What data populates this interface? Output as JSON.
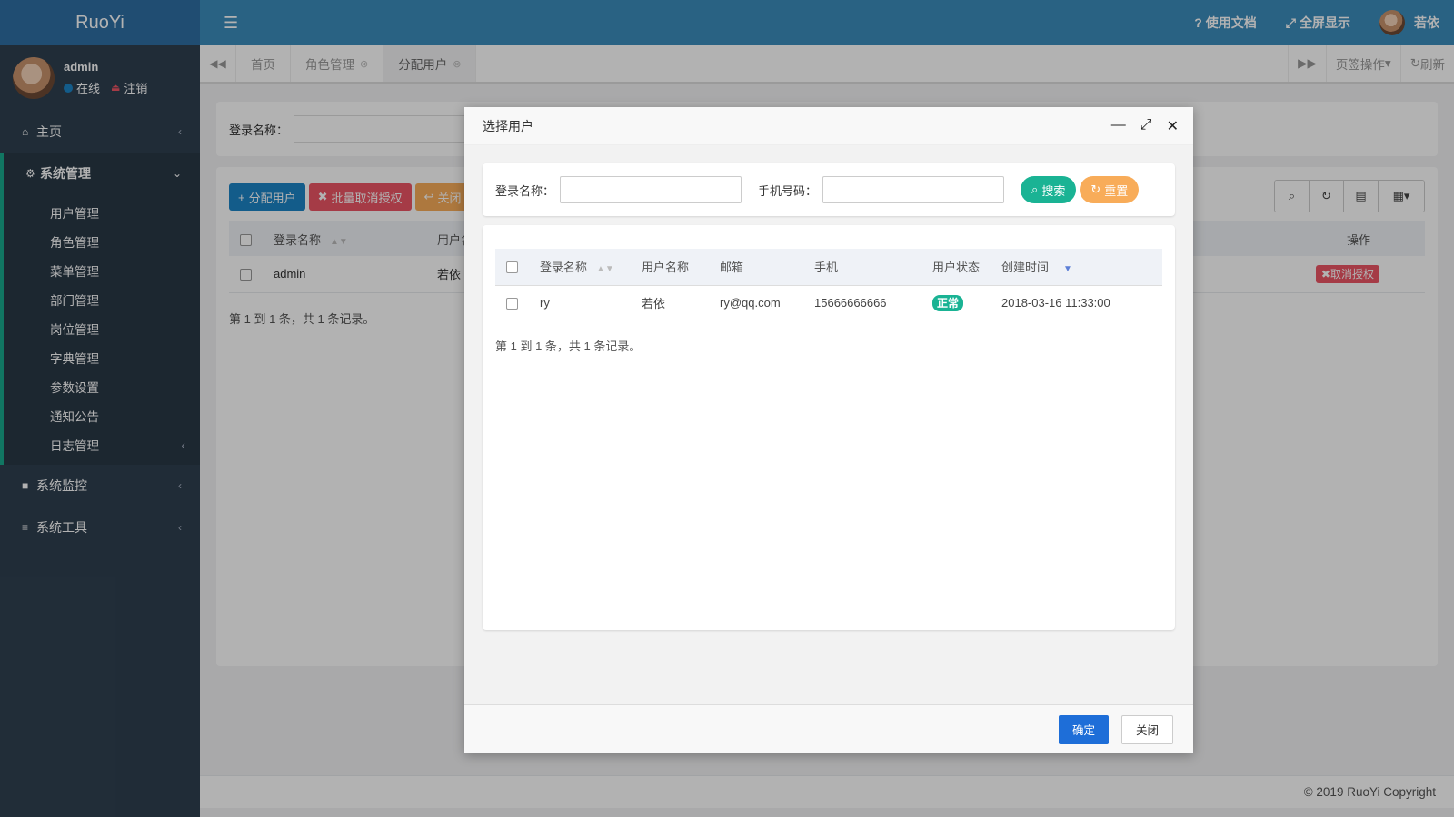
{
  "app": {
    "logo": "RuoYi"
  },
  "sidebar": {
    "user": {
      "name": "admin",
      "status": "在线",
      "logout": "注销"
    },
    "home": "主页",
    "system": "系统管理",
    "system_items": [
      "用户管理",
      "角色管理",
      "菜单管理",
      "部门管理",
      "岗位管理",
      "字典管理",
      "参数设置",
      "通知公告",
      "日志管理"
    ],
    "monitor": "系统监控",
    "tools": "系统工具"
  },
  "topbar": {
    "docs": "使用文档",
    "fullscreen": "全屏显示",
    "user": "若依"
  },
  "tabs": {
    "items": [
      "首页",
      "角色管理",
      "分配用户"
    ],
    "page_ops": "页签操作",
    "refresh": "刷新"
  },
  "main": {
    "search_label": "登录名称：",
    "buttons": {
      "assign": "分配用户",
      "batch_revoke": "批量取消授权",
      "close": "关闭"
    },
    "table": {
      "headers": [
        "登录名称",
        "用户名称",
        "操作"
      ],
      "row": {
        "login": "admin",
        "name": "若依",
        "action": "取消授权"
      }
    },
    "page_info": "第 1 到 1 条，共 1 条记录。"
  },
  "footer": "© 2019 RuoYi Copyright",
  "modal": {
    "title": "选择用户",
    "search": {
      "login_label": "登录名称：",
      "phone_label": "手机号码：",
      "search_btn": "搜索",
      "reset_btn": "重置"
    },
    "table": {
      "headers": [
        "登录名称",
        "用户名称",
        "邮箱",
        "手机",
        "用户状态",
        "创建时间"
      ],
      "rows": [
        {
          "login": "ry",
          "name": "若依",
          "email": "ry@qq.com",
          "phone": "15666666666",
          "status": "正常",
          "created": "2018-03-16 11:33:00"
        }
      ]
    },
    "page_info": "第 1 到 1 条，共 1 条记录。",
    "confirm": "确定",
    "close": "关闭"
  }
}
